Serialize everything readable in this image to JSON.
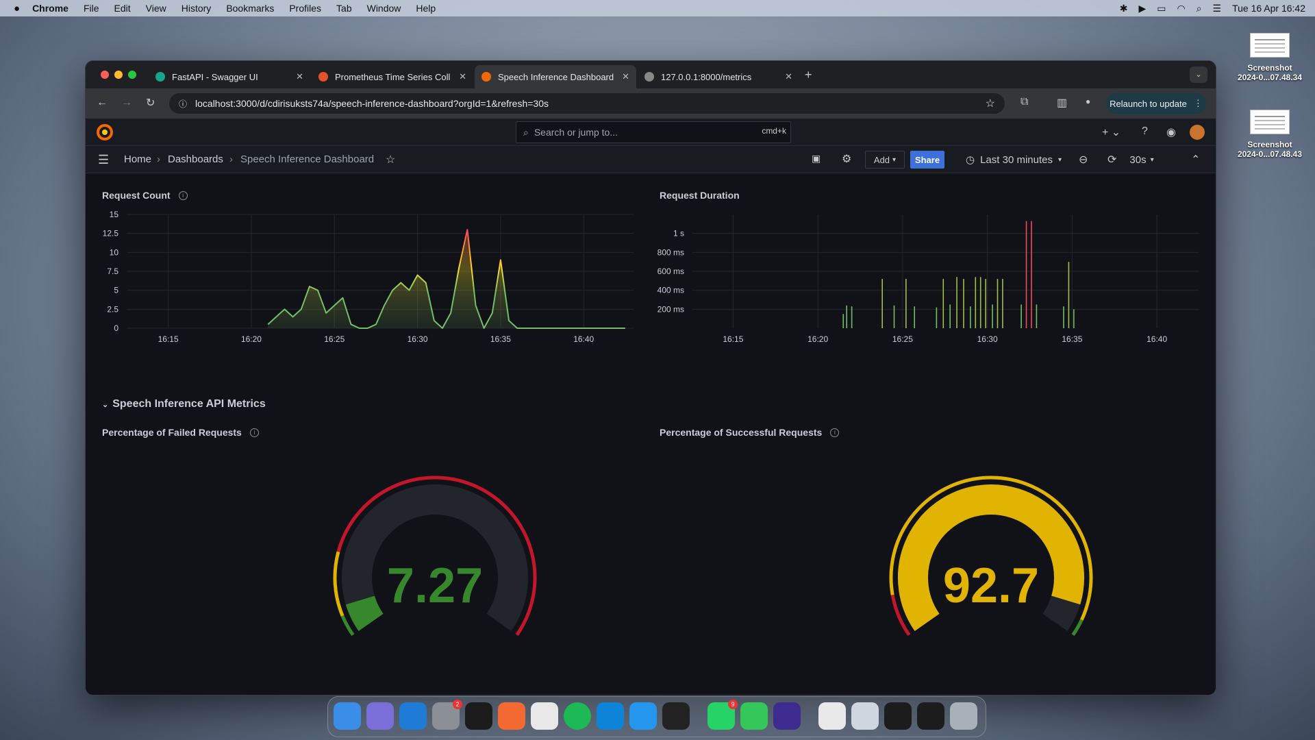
{
  "menubar": {
    "app": "Chrome",
    "items": [
      "File",
      "Edit",
      "View",
      "History",
      "Bookmarks",
      "Profiles",
      "Tab",
      "Window",
      "Help"
    ],
    "datetime": "Tue 16 Apr  16:42"
  },
  "desktop": {
    "files": [
      {
        "name": "Screenshot",
        "date": "2024-0...07.48.34"
      },
      {
        "name": "Screenshot",
        "date": "2024-0...07.48.43"
      }
    ]
  },
  "browser": {
    "tabs": [
      {
        "title": "FastAPI - Swagger UI",
        "color": "#17a589"
      },
      {
        "title": "Prometheus Time Series Coll",
        "color": "#e6522c"
      },
      {
        "title": "Speech Inference Dashboard",
        "color": "#f46800"
      },
      {
        "title": "127.0.0.1:8000/metrics",
        "color": "#888888"
      }
    ],
    "url": "localhost:3000/d/cdirisuksts74a/speech-inference-dashboard?orgId=1&refresh=30s",
    "relaunch": "Relaunch to update"
  },
  "grafana": {
    "search_placeholder": "Search or jump to...",
    "search_kbd": "cmd+k",
    "breadcrumb": [
      "Home",
      "Dashboards",
      "Speech Inference Dashboard"
    ],
    "add_label": "Add",
    "share_label": "Share",
    "time_range": "Last 30 minutes",
    "refresh": "30s",
    "row_title": "Speech Inference API Metrics",
    "panels": {
      "request_count": "Request Count",
      "request_duration": "Request Duration",
      "failed": "Percentage of Failed Requests",
      "success": "Percentage of Successful Requests"
    }
  },
  "chart_data": [
    {
      "type": "area",
      "title": "Request Count",
      "x": [
        "16:21",
        "16:21.5",
        "16:22",
        "16:22.5",
        "16:23",
        "16:23.5",
        "16:24",
        "16:24.5",
        "16:25",
        "16:25.5",
        "16:26",
        "16:26.5",
        "16:27",
        "16:27.5",
        "16:28",
        "16:28.5",
        "16:29",
        "16:29.5",
        "16:30",
        "16:30.5",
        "16:31",
        "16:31.5",
        "16:32",
        "16:32.5",
        "16:33",
        "16:33.5",
        "16:34",
        "16:34.5",
        "16:35",
        "16:35.5",
        "16:36",
        "16:36.5"
      ],
      "y": [
        0.5,
        1.5,
        2.5,
        1.5,
        2.5,
        5.5,
        5,
        2,
        3,
        4,
        0.5,
        0,
        0,
        0.5,
        3,
        5,
        6,
        5,
        7,
        6,
        1,
        0,
        2,
        8,
        13,
        3,
        0,
        2,
        9,
        1,
        0,
        0
      ],
      "xticks": [
        "16:15",
        "16:20",
        "16:25",
        "16:30",
        "16:35",
        "16:40"
      ],
      "yticks": [
        "0",
        "2.5",
        "5",
        "7.5",
        "10",
        "12.5",
        "15"
      ],
      "ylim": [
        0,
        15
      ]
    },
    {
      "type": "bar",
      "title": "Request Duration",
      "unit": "ms",
      "x": [
        "16:21.5",
        "16:21.7",
        "16:22",
        "16:23.8",
        "16:24.5",
        "16:25.2",
        "16:25.7",
        "16:27",
        "16:27.4",
        "16:27.8",
        "16:28.2",
        "16:28.6",
        "16:29",
        "16:29.3",
        "16:29.6",
        "16:29.9",
        "16:30.3",
        "16:30.6",
        "16:30.9",
        "16:32",
        "16:32.3",
        "16:32.6",
        "16:32.9",
        "16:34.5",
        "16:34.8",
        "16:35.1"
      ],
      "values": [
        150,
        240,
        230,
        520,
        240,
        520,
        230,
        220,
        520,
        250,
        540,
        520,
        230,
        540,
        540,
        520,
        250,
        520,
        520,
        250,
        1130,
        1130,
        250,
        230,
        700,
        200
      ],
      "xticks": [
        "16:15",
        "16:20",
        "16:25",
        "16:30",
        "16:35",
        "16:40"
      ],
      "yticks": [
        "200 ms",
        "400 ms",
        "600 ms",
        "800 ms",
        "1 s"
      ],
      "ylim": [
        0,
        1200
      ]
    },
    {
      "type": "gauge",
      "title": "Percentage of Failed Requests",
      "value": 7.27,
      "display": "7.27",
      "max": 100
    },
    {
      "type": "gauge",
      "title": "Percentage of Successful Requests",
      "value": 92.7,
      "display": "92.7",
      "max": 100
    }
  ]
}
